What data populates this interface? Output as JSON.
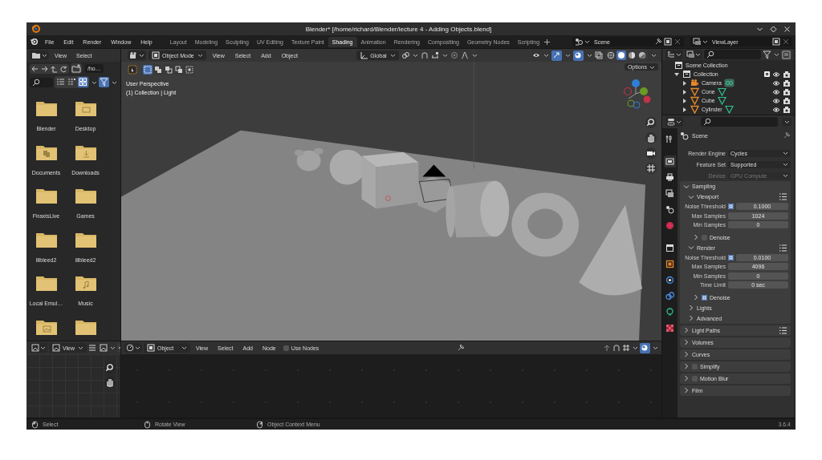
{
  "window": {
    "title": "Blender* [/home/richard/Blender/lecture 4 - Adding Objects.blend]"
  },
  "menu_bar": [
    "File",
    "Edit",
    "Render",
    "Window",
    "Help"
  ],
  "workspace_tabs": [
    {
      "label": "Layout",
      "selected": false
    },
    {
      "label": "Modeling",
      "selected": false
    },
    {
      "label": "Sculpting",
      "selected": false
    },
    {
      "label": "UV Editing",
      "selected": false
    },
    {
      "label": "Texture Paint",
      "selected": false
    },
    {
      "label": "Shading",
      "selected": true
    },
    {
      "label": "Animation",
      "selected": false
    },
    {
      "label": "Rendering",
      "selected": false
    },
    {
      "label": "Compositing",
      "selected": false
    },
    {
      "label": "Geometry Nodes",
      "selected": false
    },
    {
      "label": "Scripting",
      "selected": false
    }
  ],
  "scene_selector": {
    "value": "Scene"
  },
  "view_layer_selector": {
    "value": "ViewLayer"
  },
  "file_browser": {
    "menu": [
      "View",
      "Select"
    ],
    "path": "/ho…",
    "display_modes": [
      {
        "selected": false
      },
      {
        "selected": false
      },
      {
        "selected": true
      }
    ],
    "filter_on": true,
    "items": [
      {
        "label": "Blender",
        "kind": "folder"
      },
      {
        "label": "Desktop",
        "kind": "desktop"
      },
      {
        "label": "Documents",
        "kind": "documents"
      },
      {
        "label": "Downloads",
        "kind": "downloads"
      },
      {
        "label": "FiraxisLive",
        "kind": "folder"
      },
      {
        "label": "Games",
        "kind": "folder"
      },
      {
        "label": "illbleed2",
        "kind": "folder"
      },
      {
        "label": "illbleed2",
        "kind": "folder"
      },
      {
        "label": "Local Emul…",
        "kind": "folder"
      },
      {
        "label": "Music",
        "kind": "music"
      },
      {
        "kind": "pictures"
      },
      {
        "kind": "folder"
      }
    ]
  },
  "viewport": {
    "mode": "Object Mode",
    "menu": [
      "View",
      "Select",
      "Add",
      "Object"
    ],
    "orientation": "Global",
    "options": "Options",
    "select_modes": [
      {
        "selected": true
      },
      {
        "selected": false
      },
      {
        "selected": false
      },
      {
        "selected": false
      },
      {
        "selected": false
      }
    ],
    "gizmos_on": true,
    "overlays_on": true,
    "shading_modes": [
      {
        "selected": false
      },
      {
        "selected": true
      },
      {
        "selected": false
      },
      {
        "selected": false
      }
    ],
    "info": [
      "User Perspective",
      "(1) Collection | Light"
    ]
  },
  "image_editor": {
    "view": "View"
  },
  "shader_editor": {
    "object": "Object",
    "menu": [
      "View",
      "Select",
      "Add",
      "Node"
    ],
    "use_nodes": {
      "label": "Use Nodes",
      "checked": false
    }
  },
  "outliner": {
    "items": [
      {
        "label": "Scene Collection",
        "children": [
          {
            "label": "Collection",
            "expanded": true,
            "checked": true,
            "children": [
              {
                "label": "Camera",
                "kind": "camera",
                "expanded": false
              },
              {
                "label": "Cone",
                "kind": "mesh",
                "expanded": false
              },
              {
                "label": "Cube",
                "kind": "mesh",
                "expanded": false
              },
              {
                "label": "Cylinder",
                "kind": "mesh",
                "expanded": false
              }
            ]
          }
        ]
      }
    ]
  },
  "properties": {
    "tabs": [
      {
        "selected": false
      },
      {
        "selected": true
      },
      {
        "selected": false
      },
      {
        "selected": false
      },
      {
        "selected": false
      },
      {
        "selected": false
      },
      {
        "selected": false
      },
      {
        "selected": false
      },
      {
        "selected": false
      },
      {
        "selected": false
      },
      {
        "selected": false
      },
      {
        "selected": false
      }
    ],
    "context": "Scene",
    "fields": [
      {
        "label": "Render Engine",
        "value": "Cycles",
        "disabled": false
      },
      {
        "label": "Feature Set",
        "value": "Supported",
        "disabled": false
      },
      {
        "label": "Device",
        "value": "GPU Compute",
        "disabled": true
      }
    ],
    "panels": [
      {
        "title": "Sampling",
        "expanded": true,
        "children": [
          {
            "title": "Viewport",
            "expanded": true,
            "presets": true,
            "rows": [
              {
                "label": "Noise Threshold",
                "checked": true,
                "value": "0.1000"
              },
              {
                "label": "Max Samples",
                "value": "1024"
              },
              {
                "label": "Min Samples",
                "value": "0"
              }
            ],
            "children": [
              {
                "title": "Denoise",
                "expanded": false,
                "checked": false
              }
            ]
          },
          {
            "title": "Render",
            "expanded": true,
            "presets": true,
            "rows": [
              {
                "label": "Noise Threshold",
                "checked": true,
                "value": "0.0100"
              },
              {
                "label": "Max Samples",
                "value": "4096"
              },
              {
                "label": "Min Samples",
                "value": "0"
              },
              {
                "label": "Time Limit",
                "value": "0 sec"
              }
            ],
            "children": [
              {
                "title": "Denoise",
                "expanded": false,
                "checked": true
              }
            ]
          },
          {
            "title": "Lights",
            "expanded": false
          },
          {
            "title": "Advanced",
            "expanded": false
          }
        ]
      },
      {
        "title": "Light Paths",
        "expanded": false,
        "presets": true
      },
      {
        "title": "Volumes",
        "expanded": false
      },
      {
        "title": "Curves",
        "expanded": false
      },
      {
        "title": "Simplify",
        "expanded": false,
        "checked": false
      },
      {
        "title": "Motion Blur",
        "expanded": false,
        "checked": false
      },
      {
        "title": "Film",
        "expanded": false
      }
    ]
  },
  "status_bar": {
    "hints": [
      "Select",
      "Rotate View",
      "Object Context Menu"
    ],
    "version": "3.6.4"
  }
}
